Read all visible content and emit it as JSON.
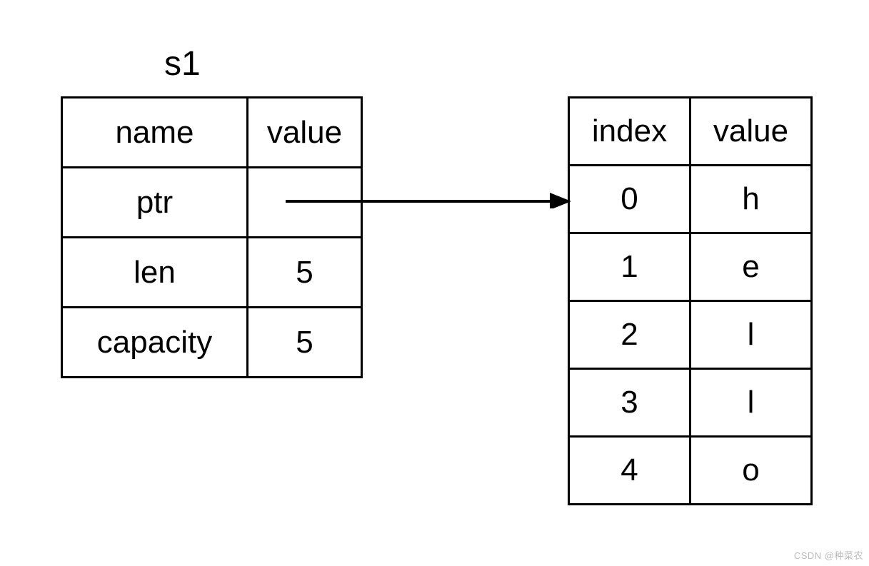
{
  "s1": {
    "title": "s1",
    "headers": {
      "name": "name",
      "value": "value"
    },
    "rows": [
      {
        "name": "ptr",
        "value": ""
      },
      {
        "name": "len",
        "value": "5"
      },
      {
        "name": "capacity",
        "value": "5"
      }
    ]
  },
  "heap": {
    "headers": {
      "index": "index",
      "value": "value"
    },
    "rows": [
      {
        "index": "0",
        "value": "h"
      },
      {
        "index": "1",
        "value": "e"
      },
      {
        "index": "2",
        "value": "l"
      },
      {
        "index": "3",
        "value": "l"
      },
      {
        "index": "4",
        "value": "o"
      }
    ]
  },
  "watermark": "CSDN @种菜农"
}
